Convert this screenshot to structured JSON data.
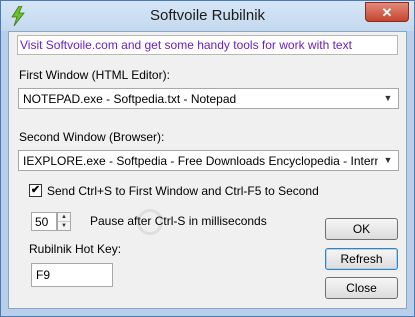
{
  "window": {
    "title": "Softvoile Rubilnik",
    "close_glyph": "✕"
  },
  "link": {
    "text": "Visit Softvoile.com and get some handy  tools for work with text"
  },
  "first_window": {
    "label": "First Window (HTML Editor):",
    "selected": "NOTEPAD.exe - Softpedia.txt - Notepad"
  },
  "second_window": {
    "label": "Second  Window (Browser):",
    "selected": "IEXPLORE.exe - Softpedia - Free Downloads Encyclopedia - Internet Explo"
  },
  "send_keys": {
    "checked": true,
    "check_glyph": "✔",
    "label": "Send Ctrl+S to First Window and Ctrl-F5 to Second"
  },
  "pause": {
    "value": "50",
    "label": "Pause after Ctrl-S in milliseconds"
  },
  "hotkey": {
    "label": "Rubilnik Hot Key:",
    "value": "F9"
  },
  "buttons": {
    "ok": "OK",
    "refresh": "Refresh",
    "close": "Close"
  },
  "colors": {
    "link": "#6a1fc4",
    "close_button": "#c6452f"
  }
}
